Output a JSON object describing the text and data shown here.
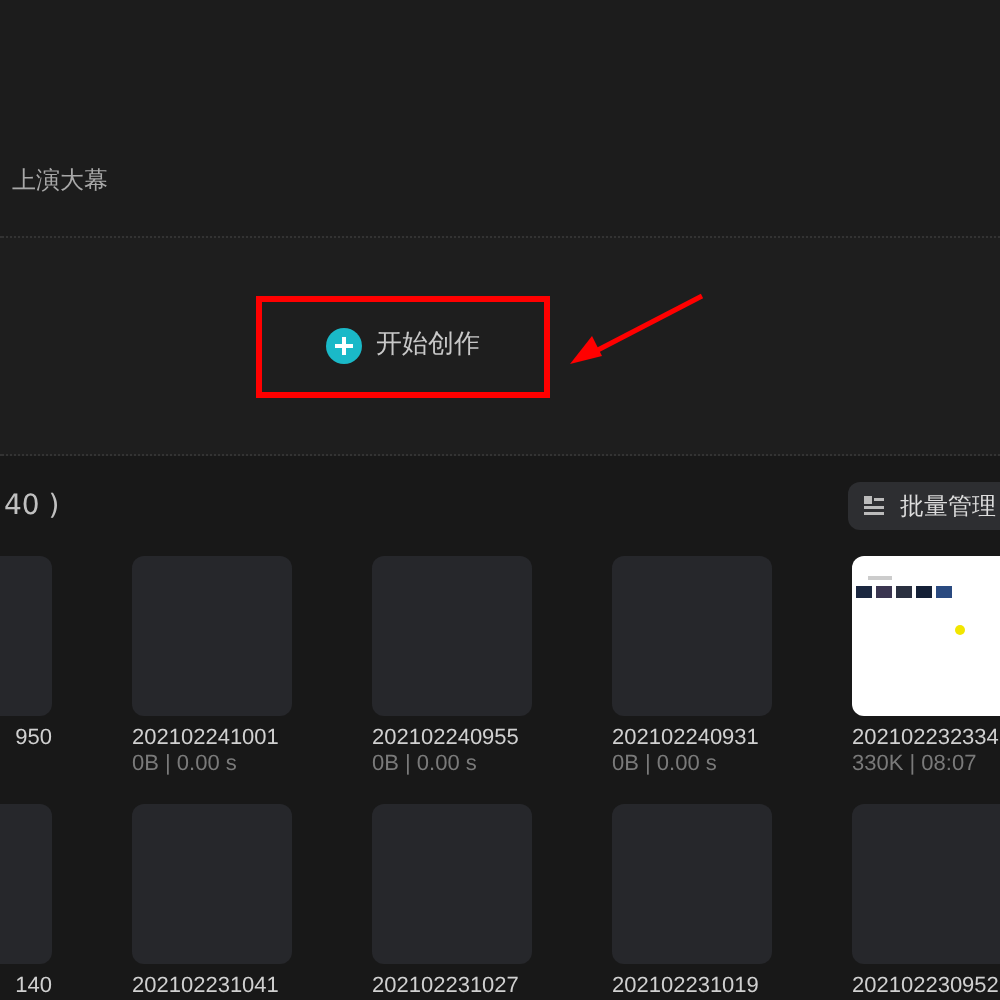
{
  "header": {
    "title": "上演大幕"
  },
  "create_button": {
    "label": "开始创作"
  },
  "annotation": {
    "kind": "highlight"
  },
  "drafts": {
    "count_text": "40 )",
    "batch_button": "批量管理",
    "rows": [
      [
        {
          "name": "950",
          "kind": "empty"
        },
        {
          "name": "202102241001",
          "meta": "0B | 0.00 s",
          "kind": "empty"
        },
        {
          "name": "202102240955",
          "meta": "0B | 0.00 s",
          "kind": "empty"
        },
        {
          "name": "202102240931",
          "meta": "0B | 0.00 s",
          "kind": "empty"
        },
        {
          "name": "202102232334",
          "meta": "330K | 08:07",
          "kind": "picture"
        }
      ],
      [
        {
          "name": "140",
          "kind": "empty"
        },
        {
          "name": "202102231041",
          "kind": "empty"
        },
        {
          "name": "202102231027",
          "kind": "empty"
        },
        {
          "name": "202102231019",
          "kind": "empty"
        },
        {
          "name": "202102230952",
          "kind": "empty"
        }
      ]
    ]
  }
}
